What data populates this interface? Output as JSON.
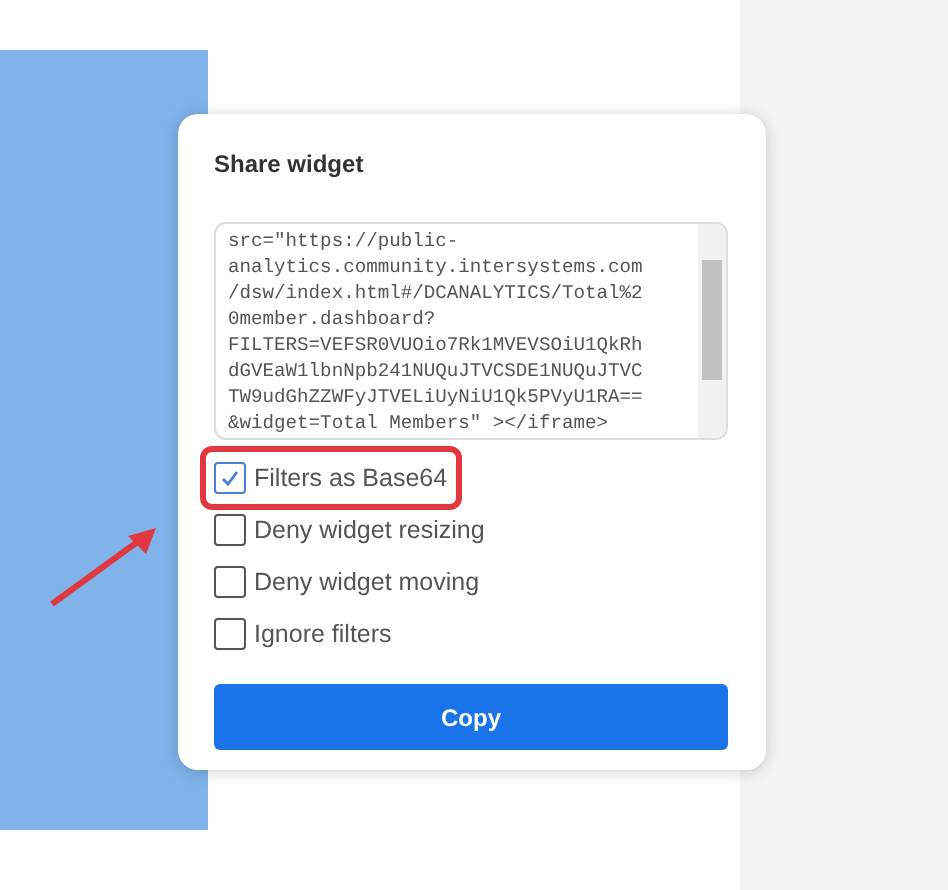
{
  "dialog": {
    "title": "Share widget",
    "code_lines": [
      "src=\"https://public-",
      "analytics.community.intersystems.com",
      "/dsw/index.html#/DCANALYTICS/Total%2",
      "0member.dashboard?",
      "FILTERS=VEFSR0VUOio7Rk1MVEVSOiU1QkRh",
      "dGVEaW1lbnNpb241NUQuJTVCSDE1NUQuJTVC",
      "TW9udGhZZWFyJTVELiUyNiU1Qk5PVyU1RA==",
      "&widget=Total Members\" ></iframe>"
    ],
    "options": [
      {
        "label": "Filters as Base64",
        "checked": true,
        "highlighted": true
      },
      {
        "label": "Deny widget resizing",
        "checked": false,
        "highlighted": false
      },
      {
        "label": "Deny widget moving",
        "checked": false,
        "highlighted": false
      },
      {
        "label": "Ignore filters",
        "checked": false,
        "highlighted": false
      }
    ],
    "copy_button": "Copy"
  }
}
